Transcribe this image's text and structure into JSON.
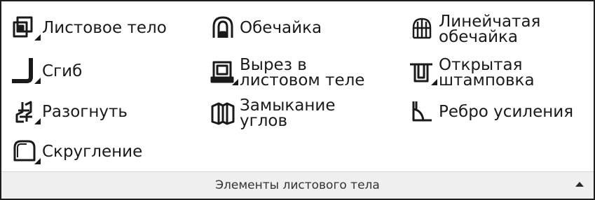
{
  "panel": {
    "title": "Элементы листового тела",
    "collapse_icon": "chevron-up-icon",
    "columns": [
      [
        {
          "label": "Листовое тело",
          "icon": "sheet-body-icon"
        },
        {
          "label": "Сгиб",
          "icon": "bend-icon"
        },
        {
          "label": "Разогнуть",
          "icon": "unbend-icon"
        },
        {
          "label": "Скругление",
          "icon": "fillet-icon"
        }
      ],
      [
        {
          "label": "Обечайка",
          "icon": "shell-icon"
        },
        {
          "label": "Вырез в\nлистовом теле",
          "icon": "cutout-icon"
        },
        {
          "label": "Замыкание\nуглов",
          "icon": "corner-closure-icon"
        }
      ],
      [
        {
          "label": "Линейчатая\nобечайка",
          "icon": "ruled-shell-icon"
        },
        {
          "label": "Открытая\nштамповка",
          "icon": "open-stamping-icon"
        },
        {
          "label": "Ребро усиления",
          "icon": "stiffener-rib-icon"
        }
      ]
    ]
  }
}
